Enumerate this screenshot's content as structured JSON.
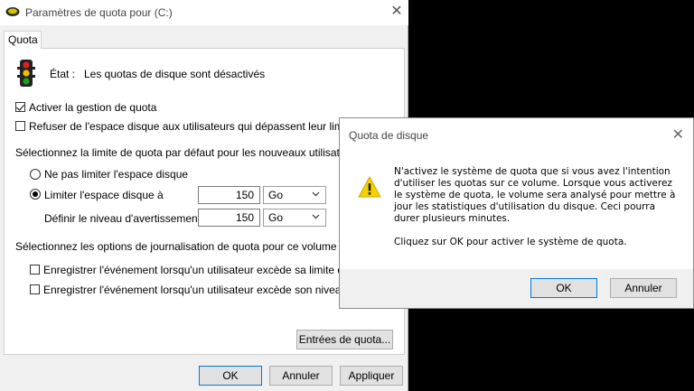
{
  "main_window": {
    "title": "Paramètres de quota pour  (C:)",
    "tab_label": "Quota",
    "status_label": "État :",
    "status_value": "Les quotas de disque sont désactivés",
    "enable_quota": {
      "label": "Activer la gestion de quota",
      "checked": true
    },
    "deny_space": {
      "label": "Refuser de l'espace disque aux utilisateurs qui dépassent leur limite de quota",
      "checked": false
    },
    "default_limit_heading": "Sélectionnez la limite de quota par défaut pour les nouveaux utilisateurs sur ce volume :",
    "no_limit_radio": {
      "label": "Ne pas limiter l'espace disque",
      "selected": false
    },
    "limit_radio": {
      "label": "Limiter l'espace disque à",
      "selected": true
    },
    "limit_value": "150",
    "limit_unit": "Go",
    "warning_label": "Définir le niveau d'avertissement à",
    "warning_value": "150",
    "warning_unit": "Go",
    "logging_heading": "Sélectionnez les options de journalisation de quota pour ce volume :",
    "log_limit": {
      "label": "Enregistrer l'événement lorsqu'un utilisateur excède sa limite de quota",
      "checked": false
    },
    "log_warning": {
      "label": "Enregistrer l'événement lorsqu'un utilisateur excède son niveau d'avertissement",
      "checked": false
    },
    "entries_button": "Entrées de quota...",
    "ok_button": "OK",
    "cancel_button": "Annuler",
    "apply_button": "Appliquer"
  },
  "dialog": {
    "title": "Quota de disque",
    "message_1": "N'activez le système de quota que si vous avez l'intention d'utiliser les quotas sur ce volume. Lorsque vous activerez le système de quota, le volume sera analysé pour mettre à jour les statistiques d'utilisation du disque. Ceci pourra durer plusieurs minutes.",
    "message_2": "Cliquez sur OK pour activer le système de quota.",
    "ok_button": "OK",
    "cancel_button": "Annuler"
  },
  "colors": {
    "accent": "#0078d7",
    "warning_yellow": "#f5d200",
    "traffic_red": "#e02020",
    "traffic_yellow": "#f0c000",
    "traffic_green": "#1ea01e"
  },
  "icons": {
    "app": "disk-icon",
    "status": "traffic-light-icon",
    "dialog": "warning-icon"
  }
}
